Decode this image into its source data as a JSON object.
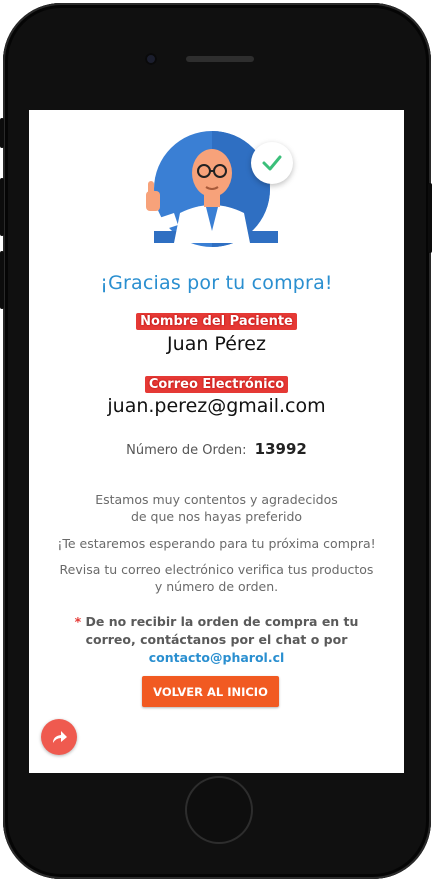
{
  "confirmation": {
    "title": "¡Gracias por tu compra!",
    "patient_label": "Nombre del Paciente",
    "patient_name": "Juan Pérez",
    "email_label": "Correo Electrónico",
    "email": "juan.perez@gmail.com",
    "order_label": "Número de Orden:",
    "order_number": "13992",
    "message_1a": "Estamos muy contentos y agradecidos",
    "message_1b": "de que nos hayas preferido",
    "message_2": "¡Te estaremos esperando para tu próxima compra!",
    "message_3a": "Revisa tu correo electrónico verifica tus productos",
    "message_3b": "y número de orden.",
    "note_star": "*",
    "note_text": "De no recibir la orden de compra en tu correo, contáctanos por el chat o por",
    "note_email": "contacto@pharol.cl",
    "button_label": "VOLVER AL INICIO"
  },
  "icons": {
    "illustration": "pharmacist-thumbs-up-illustration",
    "check": "check-icon",
    "share": "share-icon"
  },
  "colors": {
    "title_blue": "#2a8fd0",
    "highlight_red": "#e53935",
    "button_orange": "#f15a22",
    "fab_red": "#ef5a4f"
  }
}
